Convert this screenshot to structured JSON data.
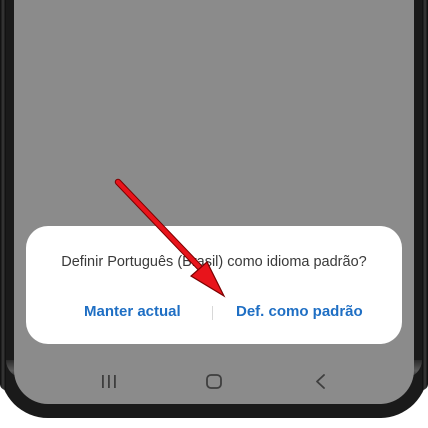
{
  "dialog": {
    "message": "Definir Português (Brasil) como idioma padrão?",
    "keep_button": "Manter actual",
    "set_default_button": "Def. como padrão"
  },
  "navbar": {
    "recent_icon": "recent-apps-icon",
    "home_icon": "home-icon",
    "back_icon": "back-icon"
  },
  "colors": {
    "screen_bg": "#8b8b8b",
    "dialog_bg": "#ffffff",
    "accent": "#1f6fc4",
    "arrow": "#e8141b"
  }
}
